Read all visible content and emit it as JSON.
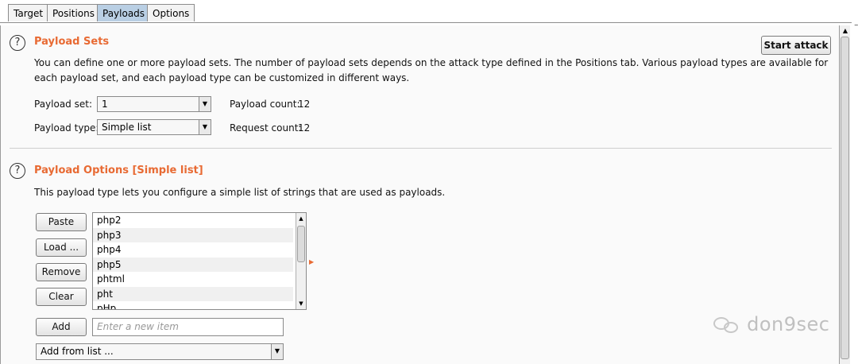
{
  "tabs": [
    {
      "label": "Target",
      "active": false
    },
    {
      "label": "Positions",
      "active": false
    },
    {
      "label": "Payloads",
      "active": true
    },
    {
      "label": "Options",
      "active": false
    }
  ],
  "payload_sets": {
    "title": "Payload Sets",
    "description_line1": "You can define one or more payload sets. The number of payload sets depends on the attack type defined in the Positions tab. Various payload types are available for",
    "description_line2": "each payload set, and each payload type can be customized in different ways.",
    "start_attack_label": "Start attack",
    "payload_set_label": "Payload set:",
    "payload_set_value": "1",
    "payload_type_label": "Payload type:",
    "payload_type_value": "Simple list",
    "payload_count_label": "Payload count:",
    "payload_count_value": "12",
    "request_count_label": "Request count:",
    "request_count_value": "12"
  },
  "payload_options": {
    "title": "Payload Options [Simple list]",
    "description": "This payload type lets you configure a simple list of strings that are used as payloads.",
    "buttons": {
      "paste": "Paste",
      "load": "Load ...",
      "remove": "Remove",
      "clear": "Clear",
      "add": "Add"
    },
    "items": [
      "php2",
      "php3",
      "php4",
      "php5",
      "phtml",
      "pht",
      "pHp"
    ],
    "new_item_placeholder": "Enter a new item",
    "add_from_list_label": "Add from list ..."
  },
  "watermark": "don9sec",
  "colors": {
    "accent": "#e86a33",
    "active_tab": "#b9cfe4"
  }
}
